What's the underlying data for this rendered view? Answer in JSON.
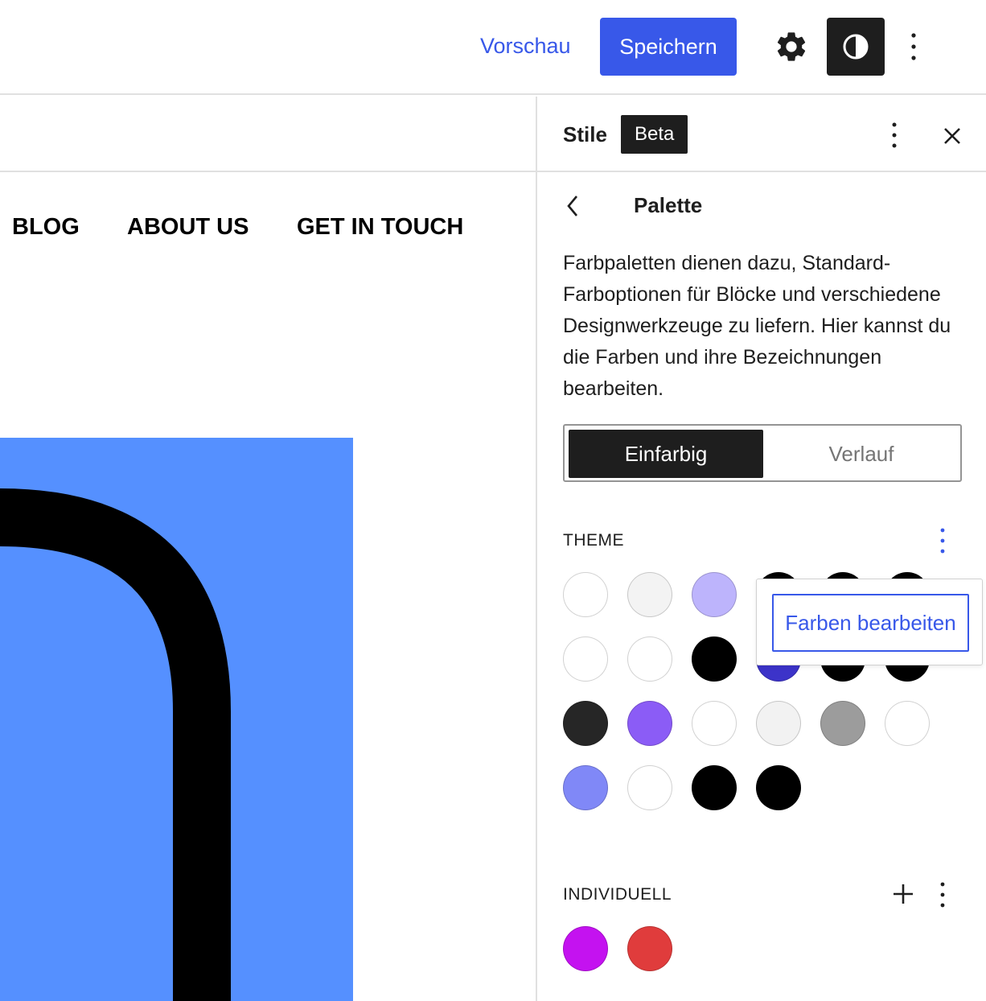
{
  "toolbar": {
    "preview_label": "Vorschau",
    "save_label": "Speichern"
  },
  "canvas": {
    "nav": [
      "BLOG",
      "ABOUT US",
      "GET IN TOUCH"
    ],
    "hero_color": "#5590ff"
  },
  "sidebar": {
    "title": "Stile",
    "badge": "Beta",
    "panel_title": "Palette",
    "description": "Farbpaletten dienen dazu, Standard-Farboptionen für Blöcke und verschiedene Designwerkzeuge zu liefern. Hier kannst du die Farben und ihre Bezeichnungen bearbeiten.",
    "segmented": {
      "solid": "Einfarbig",
      "gradient": "Verlauf",
      "selected": "Einfarbig"
    },
    "theme": {
      "label": "THEME",
      "colors": [
        [
          "#ffffff",
          "#f3f3f3",
          "#bdb4fc",
          "#000000",
          "#000000",
          "#000000"
        ],
        [
          "#ffffff",
          "#ffffff",
          "#000000",
          "#3c33c9",
          "#000000",
          "#000000"
        ],
        [
          "#262626",
          "#8b5cf6",
          "#ffffff",
          "#f2f2f2",
          "#9c9c9c",
          "#ffffff"
        ],
        [
          "#8088f7",
          "#ffffff",
          "#000000",
          "#000000"
        ]
      ]
    },
    "custom": {
      "label": "INDIVIDUELL",
      "colors": [
        "#c412f0",
        "#e03c3c"
      ]
    },
    "popover": {
      "item": "Farben bearbeiten"
    }
  },
  "colors": {
    "accent": "#3858e9",
    "dark": "#1e1e1e"
  }
}
